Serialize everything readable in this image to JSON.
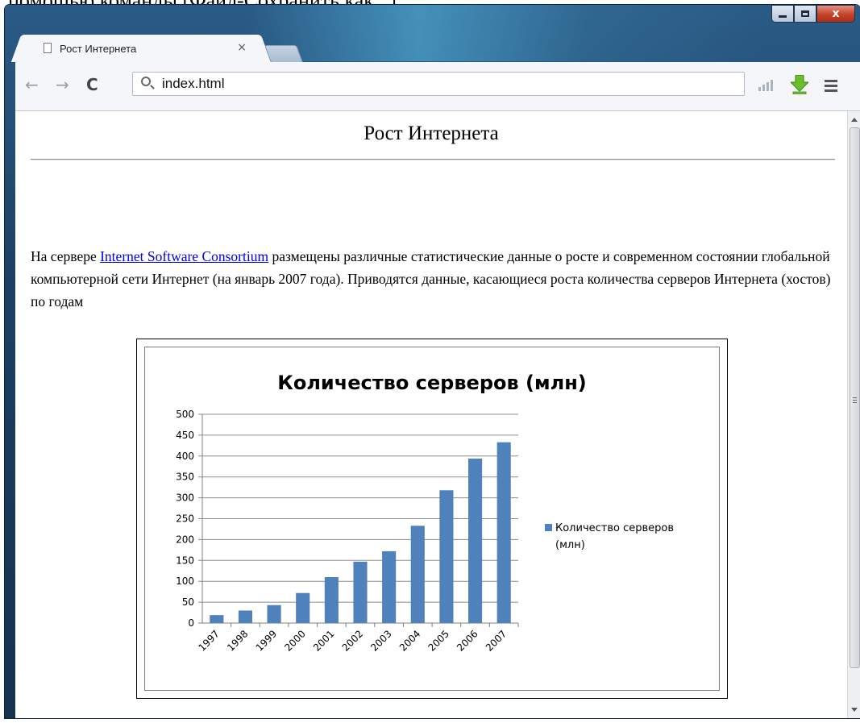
{
  "doc_above_window": "помощью команды [Файл-Сохранить как...].",
  "tab": {
    "title": "Рост Интернета",
    "close_label": "×"
  },
  "toolbar": {
    "back_label": "←",
    "forward_label": "→",
    "reload_label": "C",
    "url": "index.html"
  },
  "window_controls": {
    "close_label": "x"
  },
  "page": {
    "heading": "Рост Интернета",
    "para_before_link": "На сервере ",
    "link_text": "Internet Software Consortium",
    "para_after_link": " размещены различные статистические данные о росте и современном состоянии глобальной компьютерной сети Интернет (на   январь 2007 года). Приводятся данные, касающиеся роста количества серверов Интернета (хостов) по годам"
  },
  "colors": {
    "bar": "#4f81bd",
    "link": "#0000ee"
  },
  "chart_data": {
    "type": "bar",
    "title": "Количество серверов (млн)",
    "categories": [
      "1997",
      "1998",
      "1999",
      "2000",
      "2001",
      "2002",
      "2003",
      "2004",
      "2005",
      "2006",
      "2007"
    ],
    "series": [
      {
        "name": "Количество серверов (млн)",
        "values": [
          19,
          30,
          43,
          72,
          110,
          147,
          172,
          233,
          318,
          394,
          433
        ]
      }
    ],
    "ylim": [
      0,
      500
    ],
    "yticks": [
      0,
      50,
      100,
      150,
      200,
      250,
      300,
      350,
      400,
      450,
      500
    ],
    "grid": true,
    "legend": "right"
  }
}
